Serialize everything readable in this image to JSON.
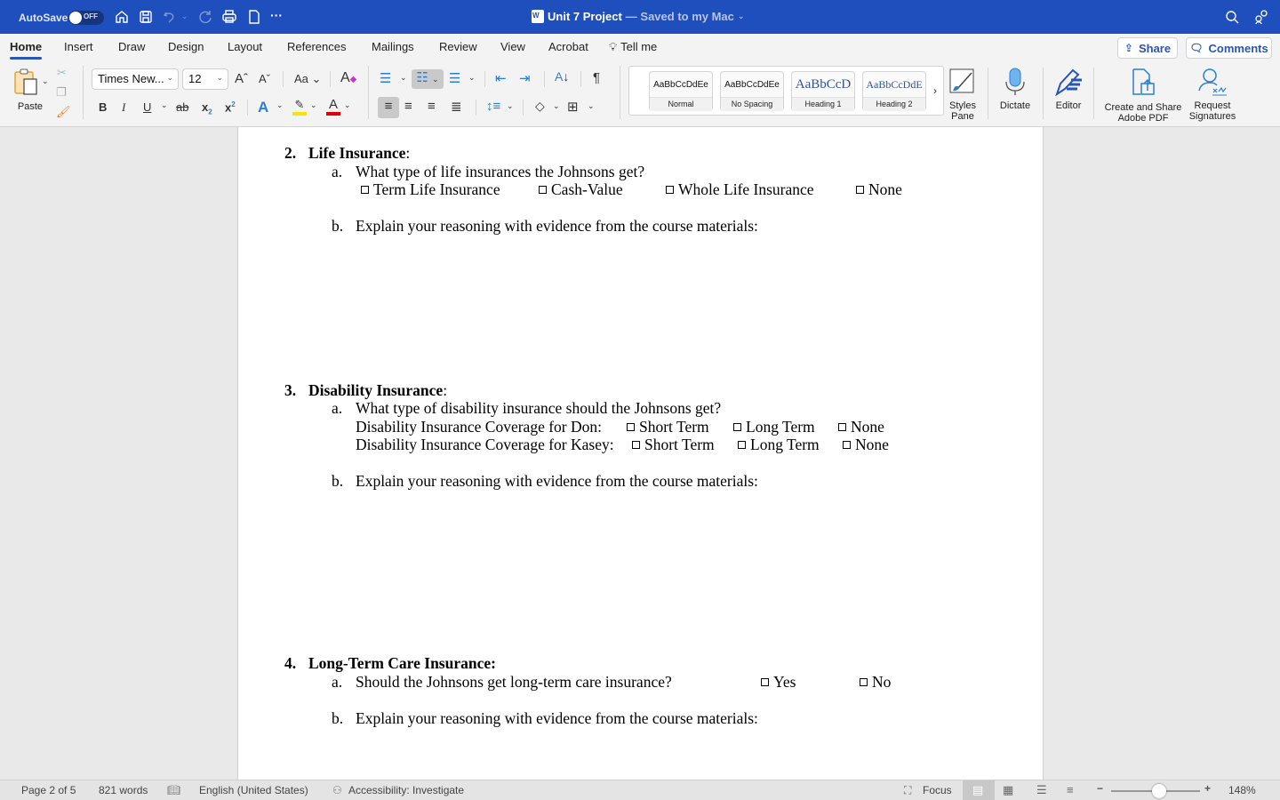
{
  "titlebar": {
    "autosave_label": "AutoSave",
    "autosave_state": "OFF",
    "doc_title": "Unit 7 Project",
    "save_status": "— Saved to my Mac",
    "icons": [
      "home-icon",
      "save-icon",
      "undo-icon",
      "redo-icon",
      "print-icon",
      "new-doc-icon",
      "more-icon",
      "search-icon",
      "people-icon"
    ]
  },
  "ribbon_tabs": [
    {
      "label": "Home",
      "active": true
    },
    {
      "label": "Insert"
    },
    {
      "label": "Draw"
    },
    {
      "label": "Design"
    },
    {
      "label": "Layout"
    },
    {
      "label": "References"
    },
    {
      "label": "Mailings"
    },
    {
      "label": "Review"
    },
    {
      "label": "View"
    },
    {
      "label": "Acrobat"
    },
    {
      "label": "Tell me"
    }
  ],
  "top_buttons": {
    "share": "Share",
    "comments": "Comments"
  },
  "ribbon": {
    "paste_label": "Paste",
    "font_name": "Times New...",
    "font_size": "12",
    "styles": [
      {
        "sample": "AaBbCcDdEe",
        "name": "Normal"
      },
      {
        "sample": "AaBbCcDdEe",
        "name": "No Spacing"
      },
      {
        "sample": "AaBbCcD",
        "name": "Heading 1"
      },
      {
        "sample": "AaBbCcDdE",
        "name": "Heading 2"
      }
    ],
    "styles_pane": "Styles Pane",
    "dictate": "Dictate",
    "editor": "Editor",
    "create_pdf": "Create and Share Adobe PDF",
    "request_signatures": "Request Signatures",
    "colors": {
      "highlight": "#f5e400",
      "font_color": "#e00000",
      "accent": "#2a55b3",
      "title_bar": "#1f4fbd"
    }
  },
  "document": {
    "sections": [
      {
        "number": "2.",
        "heading": "Life Insurance",
        "heading_suffix": ":",
        "question_a_marker": "a.",
        "question_a": "What type of life insurances the Johnsons get?",
        "options": [
          "Term Life Insurance",
          "Cash-Value",
          "Whole Life Insurance",
          "None"
        ],
        "question_b_marker": "b.",
        "question_b": "Explain your reasoning with evidence from the course materials:"
      },
      {
        "number": "3.",
        "heading": "Disability Insurance",
        "heading_suffix": ":",
        "question_a_marker": "a.",
        "question_a": "What type of disability insurance should the Johnsons get?",
        "rows": [
          {
            "label": "Disability Insurance Coverage for Don:",
            "options": [
              "Short Term",
              "Long Term",
              "None"
            ]
          },
          {
            "label": "Disability Insurance Coverage for Kasey:",
            "options": [
              "Short Term",
              "Long Term",
              "None"
            ]
          }
        ],
        "question_b_marker": "b.",
        "question_b": "Explain your reasoning with evidence from the course materials:"
      },
      {
        "number": "4.",
        "heading": "Long-Term Care Insurance:",
        "question_a_marker": "a.",
        "question_a": "Should the Johnsons get long-term care insurance?",
        "options": [
          "Yes",
          "No"
        ],
        "question_b_marker": "b.",
        "question_b": "Explain your reasoning with evidence from the course materials:"
      }
    ]
  },
  "statusbar": {
    "page": "Page 2 of 5",
    "words": "821 words",
    "language": "English (United States)",
    "accessibility": "Accessibility: Investigate",
    "focus": "Focus",
    "zoom_level": "148%"
  }
}
